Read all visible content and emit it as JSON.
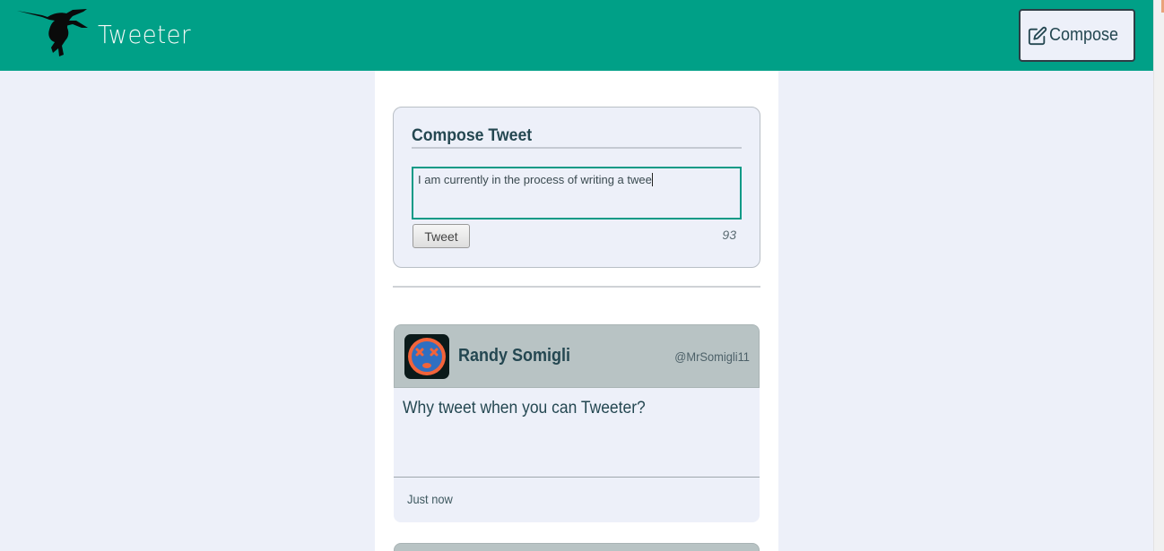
{
  "header": {
    "app_title": "Tweeter",
    "logo_icon": "hummingbird-icon",
    "compose_button": {
      "label": "Compose",
      "icon": "edit-icon"
    },
    "colors": {
      "bar": "#00a087",
      "page": "#edf0f9"
    }
  },
  "composer": {
    "title": "Compose Tweet",
    "input_value": "I am currently in the process of writing a twee",
    "submit_label": "Tweet",
    "char_counter": "93"
  },
  "tweets": [
    {
      "author_name": "Randy Somigli",
      "handle": "@MrSomigli11",
      "avatar_icon": "dizzy-face-avatar",
      "body": "Why tweet when you can Tweeter?",
      "timestamp": "Just now"
    }
  ]
}
